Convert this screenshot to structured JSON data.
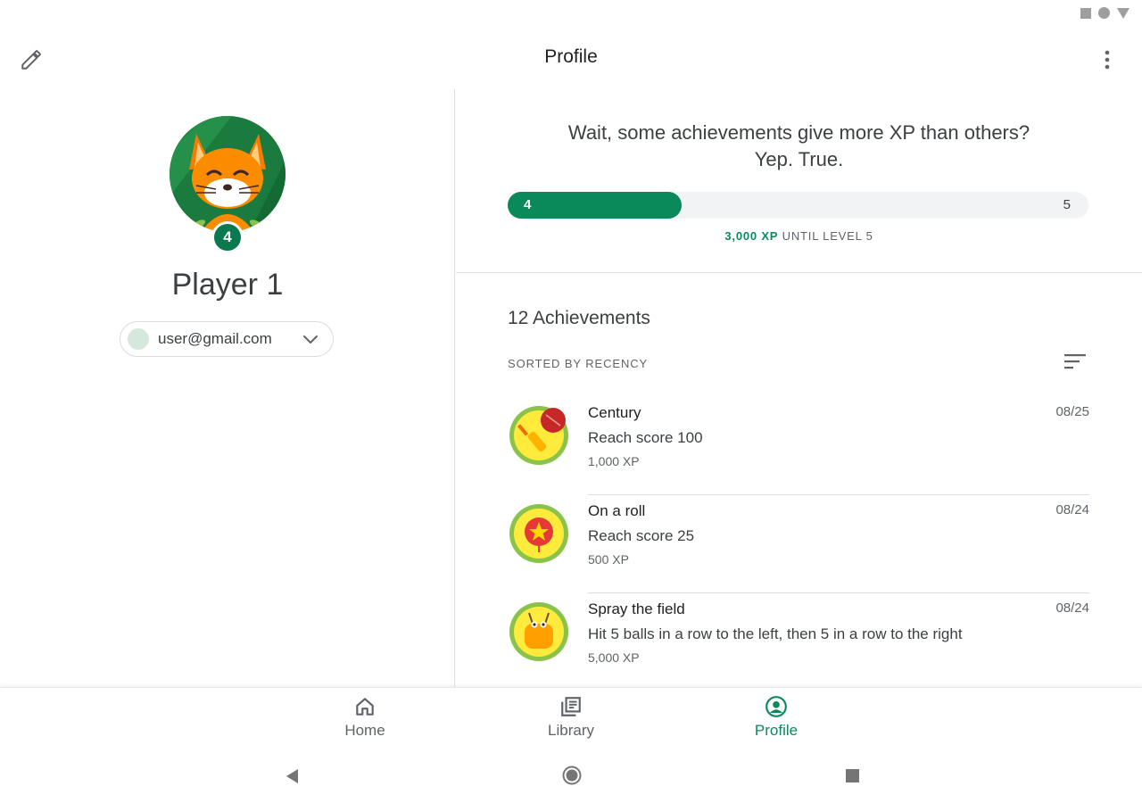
{
  "app_bar": {
    "title": "Profile",
    "edit_icon": "pencil-icon",
    "more_icon": "more-vert-icon"
  },
  "profile": {
    "level": "4",
    "player_name": "Player 1",
    "account_email": "user@gmail.com"
  },
  "progress": {
    "headline_line1": "Wait, some achievements give more XP than others?",
    "headline_line2": "Yep. True.",
    "current_level": "4",
    "next_level": "5",
    "fill_fraction": 0.3,
    "xp_amount": "3,000 XP",
    "caption_suffix": " UNTIL LEVEL 5"
  },
  "achievements": {
    "count_label": "12 Achievements",
    "sort_label": "SORTED BY RECENCY",
    "items": [
      {
        "name": "Century",
        "description": "Reach score 100",
        "xp": "1,000 XP",
        "date": "08/25",
        "icon": "cricket-bat-ball-icon"
      },
      {
        "name": "On a roll",
        "description": "Reach score 25",
        "xp": "500 XP",
        "date": "08/24",
        "icon": "star-medal-icon"
      },
      {
        "name": "Spray the field",
        "description": "Hit 5 balls in a row to the left, then 5 in a row to the right",
        "xp": "5,000 XP",
        "date": "08/24",
        "icon": "bug-character-icon"
      }
    ]
  },
  "bottom_nav": {
    "home": "Home",
    "library": "Library",
    "profile": "Profile"
  },
  "colors": {
    "accent": "#0a8a5a",
    "badge": "#0a7a4e",
    "track": "#f1f3f4"
  }
}
